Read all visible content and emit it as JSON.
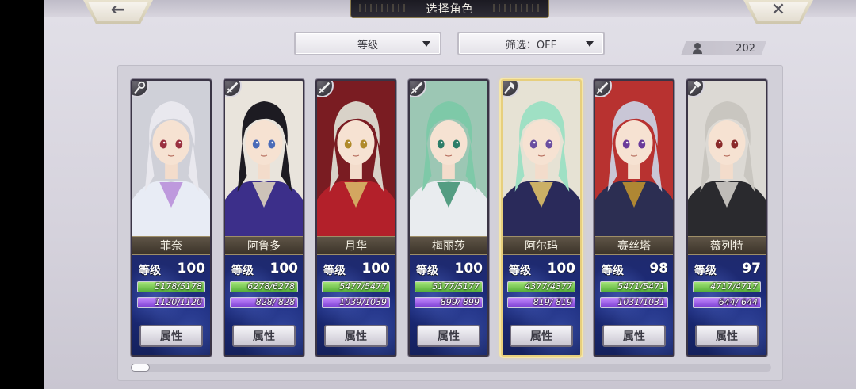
{
  "header": {
    "title": "选择角色",
    "back_icon": "←",
    "close_icon": "✕"
  },
  "sort_dropdown": {
    "value": "等级"
  },
  "filter_dropdown": {
    "value": "筛选：OFF"
  },
  "character_count": "202",
  "characters": [
    {
      "name": "菲奈",
      "level_label": "等级",
      "level": "100",
      "hp": "5178/5178",
      "mp": "1120/1120",
      "attr_label": "属性",
      "weapon_icon": "staff-icon",
      "hair": "#e9e8ee",
      "eyes": "#9a3040",
      "outfit": "#e8ecf5",
      "accent": "#b68bd8",
      "bg": "#cfd0d8"
    },
    {
      "name": "阿鲁多",
      "level_label": "等级",
      "level": "100",
      "hp": "6278/6278",
      "mp": "828/ 828",
      "attr_label": "属性",
      "weapon_icon": "sword-icon",
      "hair": "#1d1b22",
      "eyes": "#4a6bb8",
      "outfit": "#3c2f8a",
      "accent": "#e6dcc0",
      "bg": "#e9e4dc"
    },
    {
      "name": "月华",
      "level_label": "等级",
      "level": "100",
      "hp": "5477/5477",
      "mp": "1039/1039",
      "attr_label": "属性",
      "weapon_icon": "sword-icon",
      "hair": "#d8d2c8",
      "eyes": "#b08a2a",
      "outfit": "#b3202a",
      "accent": "#d8c06a",
      "bg": "#7a1c22"
    },
    {
      "name": "梅丽莎",
      "level_label": "等级",
      "level": "100",
      "hp": "5177/5177",
      "mp": "899/ 899",
      "attr_label": "属性",
      "weapon_icon": "sword-icon",
      "hair": "#7ec9a8",
      "eyes": "#2d7d68",
      "outfit": "#e9ecef",
      "accent": "#3a8f6e",
      "bg": "#9cc7b4"
    },
    {
      "name": "阿尔玛",
      "level_label": "等级",
      "level": "100",
      "hp": "4377/4377",
      "mp": "819/ 819",
      "attr_label": "属性",
      "weapon_icon": "axe-icon",
      "hair": "#9fe0c4",
      "eyes": "#6a4ea0",
      "outfit": "#2a2a5a",
      "accent": "#e8c868",
      "bg": "#e6e2d4"
    },
    {
      "name": "赛丝塔",
      "level_label": "等级",
      "level": "98",
      "hp": "5471/5471",
      "mp": "1031/1031",
      "attr_label": "属性",
      "weapon_icon": "sword-icon",
      "hair": "#c9c6d6",
      "eyes": "#6a3a9a",
      "outfit": "#2c2e52",
      "accent": "#c7962e",
      "bg": "#b83230"
    },
    {
      "name": "薇列特",
      "level_label": "等级",
      "level": "97",
      "hp": "4717/4717",
      "mp": "644/ 644",
      "attr_label": "属性",
      "weapon_icon": "hammer-icon",
      "hair": "#c9c6c0",
      "eyes": "#8a2a2a",
      "outfit": "#2a2a2e",
      "accent": "#d9d6d0",
      "bg": "#dcd9d4"
    }
  ]
}
